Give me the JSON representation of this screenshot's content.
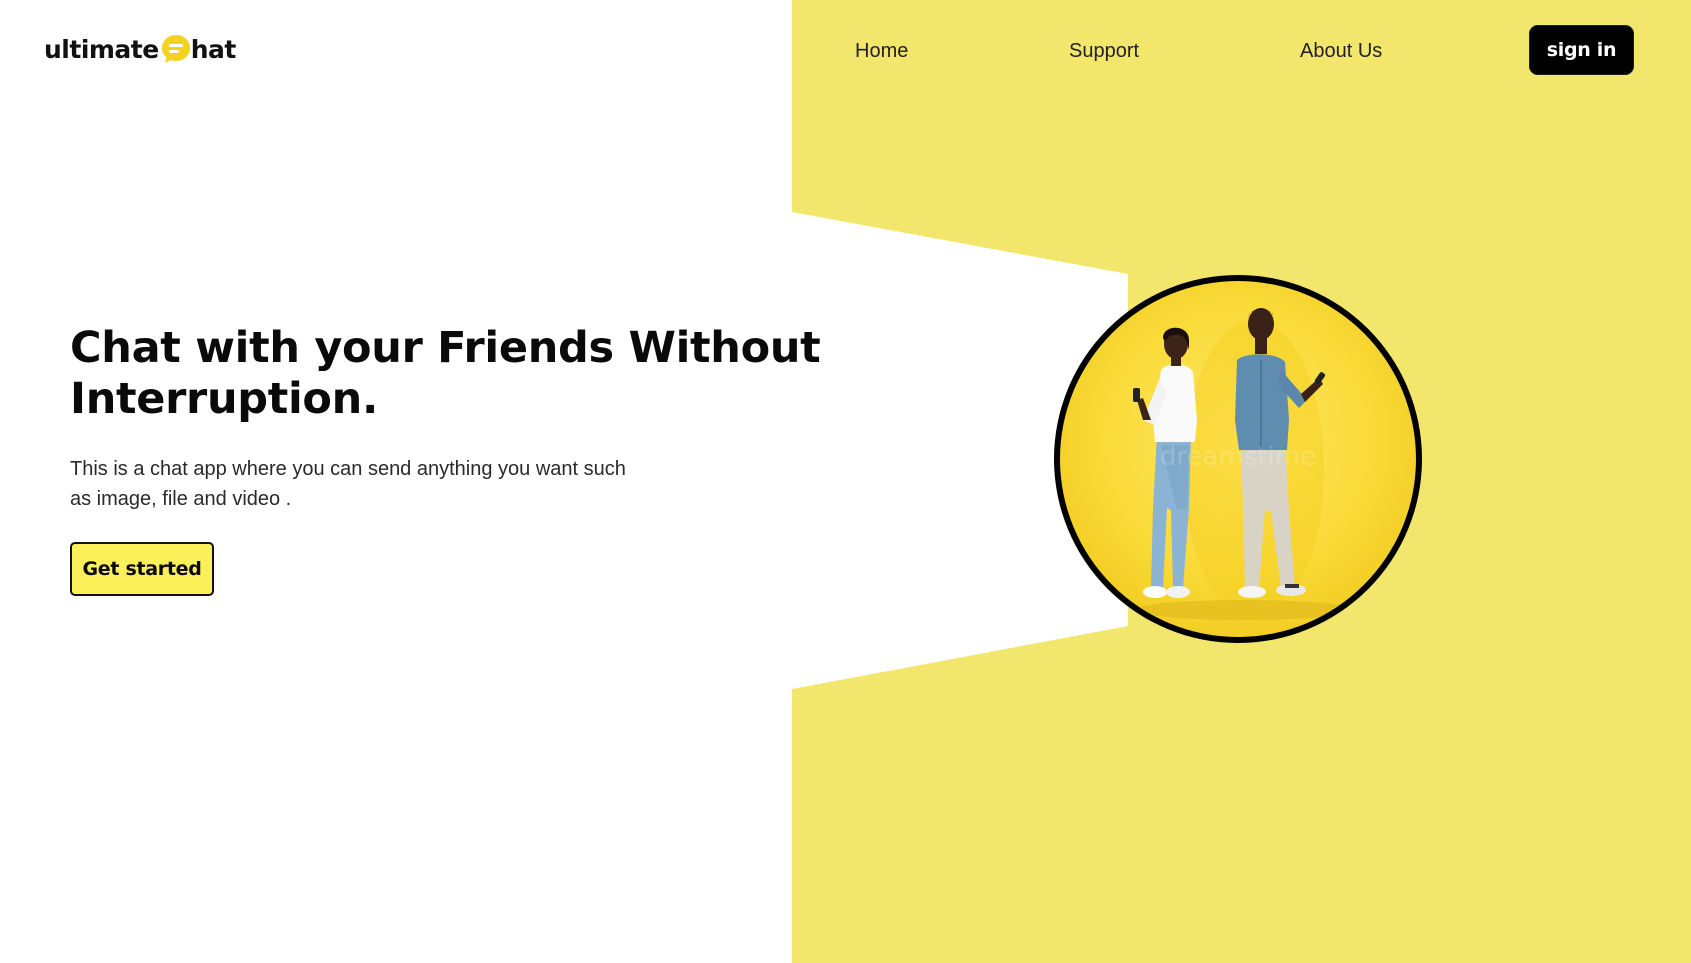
{
  "brand": {
    "name_left": "ultimate",
    "name_right": "hat",
    "logo_icon": "chat-bubble-icon"
  },
  "nav": {
    "items": [
      {
        "label": "Home"
      },
      {
        "label": "Support"
      },
      {
        "label": "About Us"
      }
    ],
    "signin_label": "sign in"
  },
  "hero": {
    "headline": "Chat with your Friends Without Interruption.",
    "description": "This is a chat app where you can send anything you want such as image, file and video .",
    "cta_label": "Get started",
    "image_icon": "couple-with-phones-photo"
  },
  "colors": {
    "accent_yellow": "#f3e66d",
    "button_yellow": "#fbf05a",
    "dark": "#000000",
    "background": "#ffffff"
  }
}
